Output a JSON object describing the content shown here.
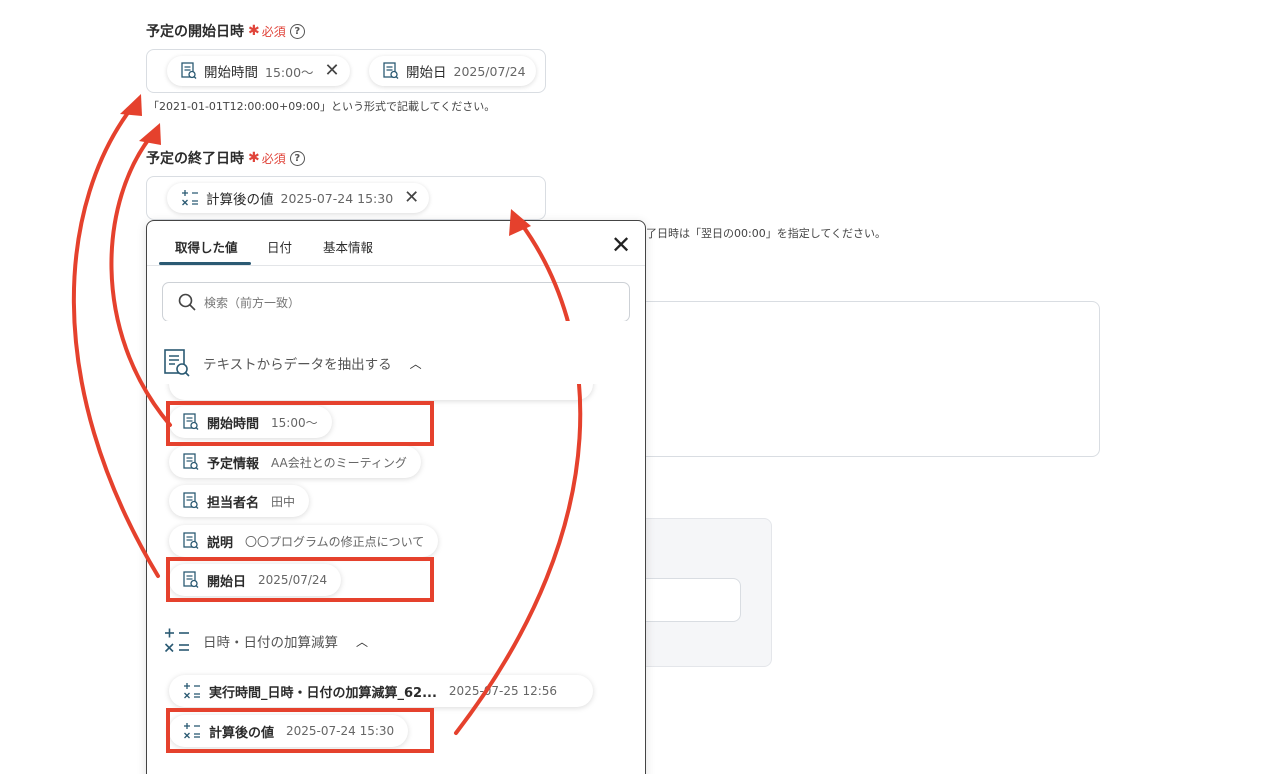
{
  "start_field": {
    "label": "予定の開始日時",
    "required": "必須",
    "help": "?",
    "chips": [
      {
        "name": "開始時間",
        "value": "15:00〜"
      },
      {
        "name": "開始日",
        "value": "2025/07/24"
      }
    ],
    "hint": "「2021-01-01T12:00:00+09:00」という形式で記載してください。"
  },
  "end_field": {
    "label": "予定の終了日時",
    "required": "必須",
    "help": "?",
    "chips": [
      {
        "name": "計算後の値",
        "value": "2025-07-24 15:30"
      }
    ],
    "hint_partial": "了日時は「翌日の00:00」を指定してください。"
  },
  "popup": {
    "tabs": [
      "取得した値",
      "日付",
      "基本情報"
    ],
    "active_tab": "取得した値",
    "search_placeholder": "検索（前方一致）",
    "sections": [
      {
        "title": "テキストからデータを抽出する",
        "icon": "text-extract-icon",
        "items": [
          {
            "name": "開始時間",
            "value": "15:00〜",
            "highlighted": true
          },
          {
            "name": "予定情報",
            "value": "AA会社とのミーティング",
            "highlighted": false
          },
          {
            "name": "担当者名",
            "value": "田中",
            "highlighted": false
          },
          {
            "name": "説明",
            "value": "〇〇プログラムの修正点について",
            "highlighted": false
          },
          {
            "name": "開始日",
            "value": "2025/07/24",
            "highlighted": true
          }
        ]
      },
      {
        "title": "日時・日付の加算減算",
        "icon": "calc-icon",
        "items": [
          {
            "name": "実行時間_日時・日付の加算減算_62...",
            "value": "2025-07-25 12:56",
            "highlighted": false
          },
          {
            "name": "計算後の値",
            "value": "2025-07-24 15:30",
            "highlighted": true
          }
        ]
      }
    ]
  },
  "colors": {
    "highlight": "#e5412d",
    "required": "#e0443a",
    "tab_underline": "#2b5a73"
  }
}
